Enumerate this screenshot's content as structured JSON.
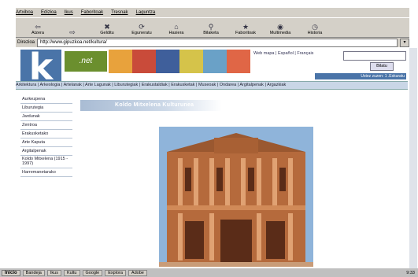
{
  "menu": [
    "Artxiboa",
    "Edizioa",
    "Ikus",
    "Faboritoak",
    "Tresnak",
    "Laguntza"
  ],
  "toolbar": [
    {
      "label": "Atzera",
      "icon": "back-arrow-icon",
      "glyph": "⇦"
    },
    {
      "label": "",
      "icon": "forward-arrow-icon",
      "glyph": "⇨"
    },
    {
      "label": "Gelditu",
      "icon": "stop-icon",
      "glyph": "✖"
    },
    {
      "label": "Eguneratu",
      "icon": "refresh-icon",
      "glyph": "⟳"
    },
    {
      "label": "Hasiera",
      "icon": "home-icon",
      "glyph": "⌂"
    },
    {
      "label": "Bilaketa",
      "icon": "search-icon",
      "glyph": "⚲"
    },
    {
      "label": "Faboritoak",
      "icon": "favorites-icon",
      "glyph": "★"
    },
    {
      "label": "Multimedia",
      "icon": "multimedia-icon",
      "glyph": "◉"
    },
    {
      "label": "Historia",
      "icon": "history-icon",
      "glyph": "◷"
    }
  ],
  "address": {
    "label": "Direzioa",
    "url": "http://www.gipuzkoa.net/kultura/"
  },
  "site": {
    "logo_letter": "k",
    "net_label": ".net",
    "top_links": "Web mapa | Español | Français",
    "search_button": "Bilatu",
    "user_line": "Ustez zuzen: 1 .Eskuratu",
    "nav_links": "Arkitektura | Arkeologia | Artelanak | Arte Lagunak | Liburutegiak | Erakustaldiak | Erakusketak | Museoak | Ondarea | Argitalpenak | Argazkiak"
  },
  "sidebar": [
    "Aurkezpena",
    "Liburutegia",
    "Jardunak",
    "Zentroa",
    "Erakusketako",
    "Arte Kaputa",
    "Argitalpenak",
    "Koldo Mitxelena (1915 - 1997)",
    "Harremanetarako"
  ],
  "banner_title": "Koldo Mitxelena Kulturunea",
  "taskbar": {
    "start": "Inicio",
    "tasks": [
      "Bandeja",
      "Ikus",
      "Kultu",
      "Google",
      "Explora",
      "Adobe"
    ],
    "clock": "9:33"
  },
  "colors": {
    "accent": "#4a74a8",
    "nav_bg": "#c9d6e6",
    "net_green": "#6b8f2e"
  }
}
